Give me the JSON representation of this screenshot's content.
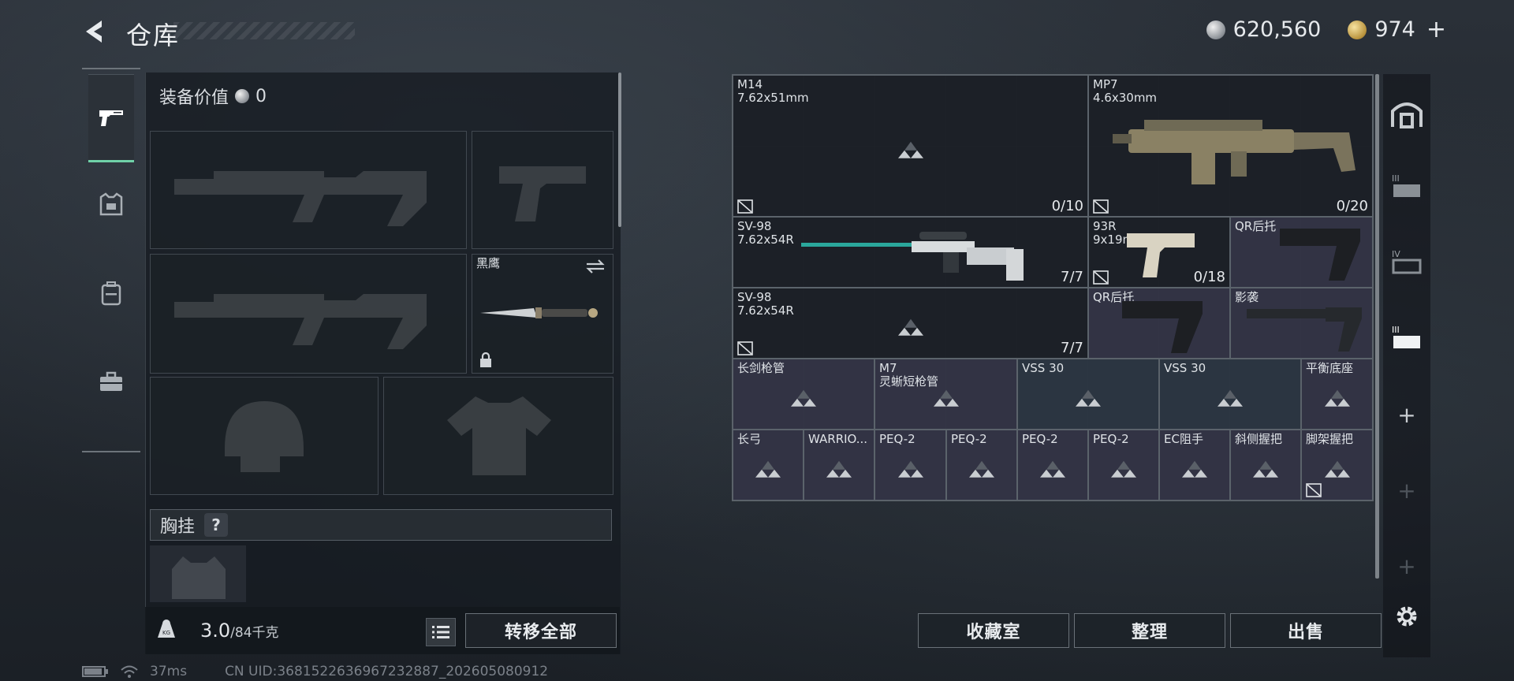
{
  "header": {
    "title": "仓库",
    "silver_amount": "620,560",
    "gold_amount": "974",
    "plus_label": "+"
  },
  "equipment": {
    "value_label": "装备价值",
    "value_amount": "0",
    "melee_name": "黑鹰",
    "chest_rig_label": "胸挂",
    "help_label": "?",
    "weight_value": "3.0",
    "weight_capacity": "/84千克",
    "transfer_all_label": "转移全部"
  },
  "storage": {
    "items": [
      {
        "name": "M14",
        "sub": "7.62x51mm",
        "count": "0/10"
      },
      {
        "name": "MP7",
        "sub": "4.6x30mm",
        "count": "0/20"
      },
      {
        "name": "SV-98",
        "sub": "7.62x54R",
        "count": "7/7"
      },
      {
        "name": "93R",
        "sub": "9x19mm",
        "count": "0/18"
      },
      {
        "name": "QR后托",
        "sub": "",
        "count": ""
      },
      {
        "name": "SV-98",
        "sub": "7.62x54R",
        "count": "7/7"
      },
      {
        "name": "QR后托",
        "sub": "",
        "count": ""
      },
      {
        "name": "影袭",
        "sub": "",
        "count": ""
      },
      {
        "name": "长剑枪管",
        "sub": "",
        "count": ""
      },
      {
        "name": "M7",
        "sub": "灵蜥短枪管",
        "count": ""
      },
      {
        "name": "VSS 30",
        "sub": "",
        "count": ""
      },
      {
        "name": "VSS 30",
        "sub": "",
        "count": ""
      },
      {
        "name": "平衡底座",
        "sub": "",
        "count": ""
      },
      {
        "name": "长弓",
        "sub": "",
        "count": ""
      },
      {
        "name": "WARRIO...",
        "sub": "",
        "count": ""
      },
      {
        "name": "PEQ-2",
        "sub": "",
        "count": ""
      },
      {
        "name": "PEQ-2",
        "sub": "",
        "count": ""
      },
      {
        "name": "PEQ-2",
        "sub": "",
        "count": ""
      },
      {
        "name": "PEQ-2",
        "sub": "",
        "count": ""
      },
      {
        "name": "EC阻手",
        "sub": "",
        "count": ""
      },
      {
        "name": "斜侧握把",
        "sub": "",
        "count": ""
      },
      {
        "name": "脚架握把",
        "sub": "",
        "count": ""
      }
    ],
    "collection_label": "收藏室",
    "sort_label": "整理",
    "sell_label": "出售"
  },
  "status": {
    "ping": "37ms",
    "uid": "CN UID:3681522636967232887_202605080912"
  },
  "icons": {
    "back": "back-arrow-icon",
    "tab_weapons": "pistol-icon",
    "tab_armor": "armor-icon",
    "tab_backpack": "backpack-icon",
    "tab_case": "case-icon",
    "empty_slot": "triangle-placeholder-icon",
    "settings": "gear-icon"
  },
  "colors": {
    "active_tab": "#6fd1a8",
    "purple_rarity": "#34354a",
    "blue_rarity": "#2c3742"
  }
}
